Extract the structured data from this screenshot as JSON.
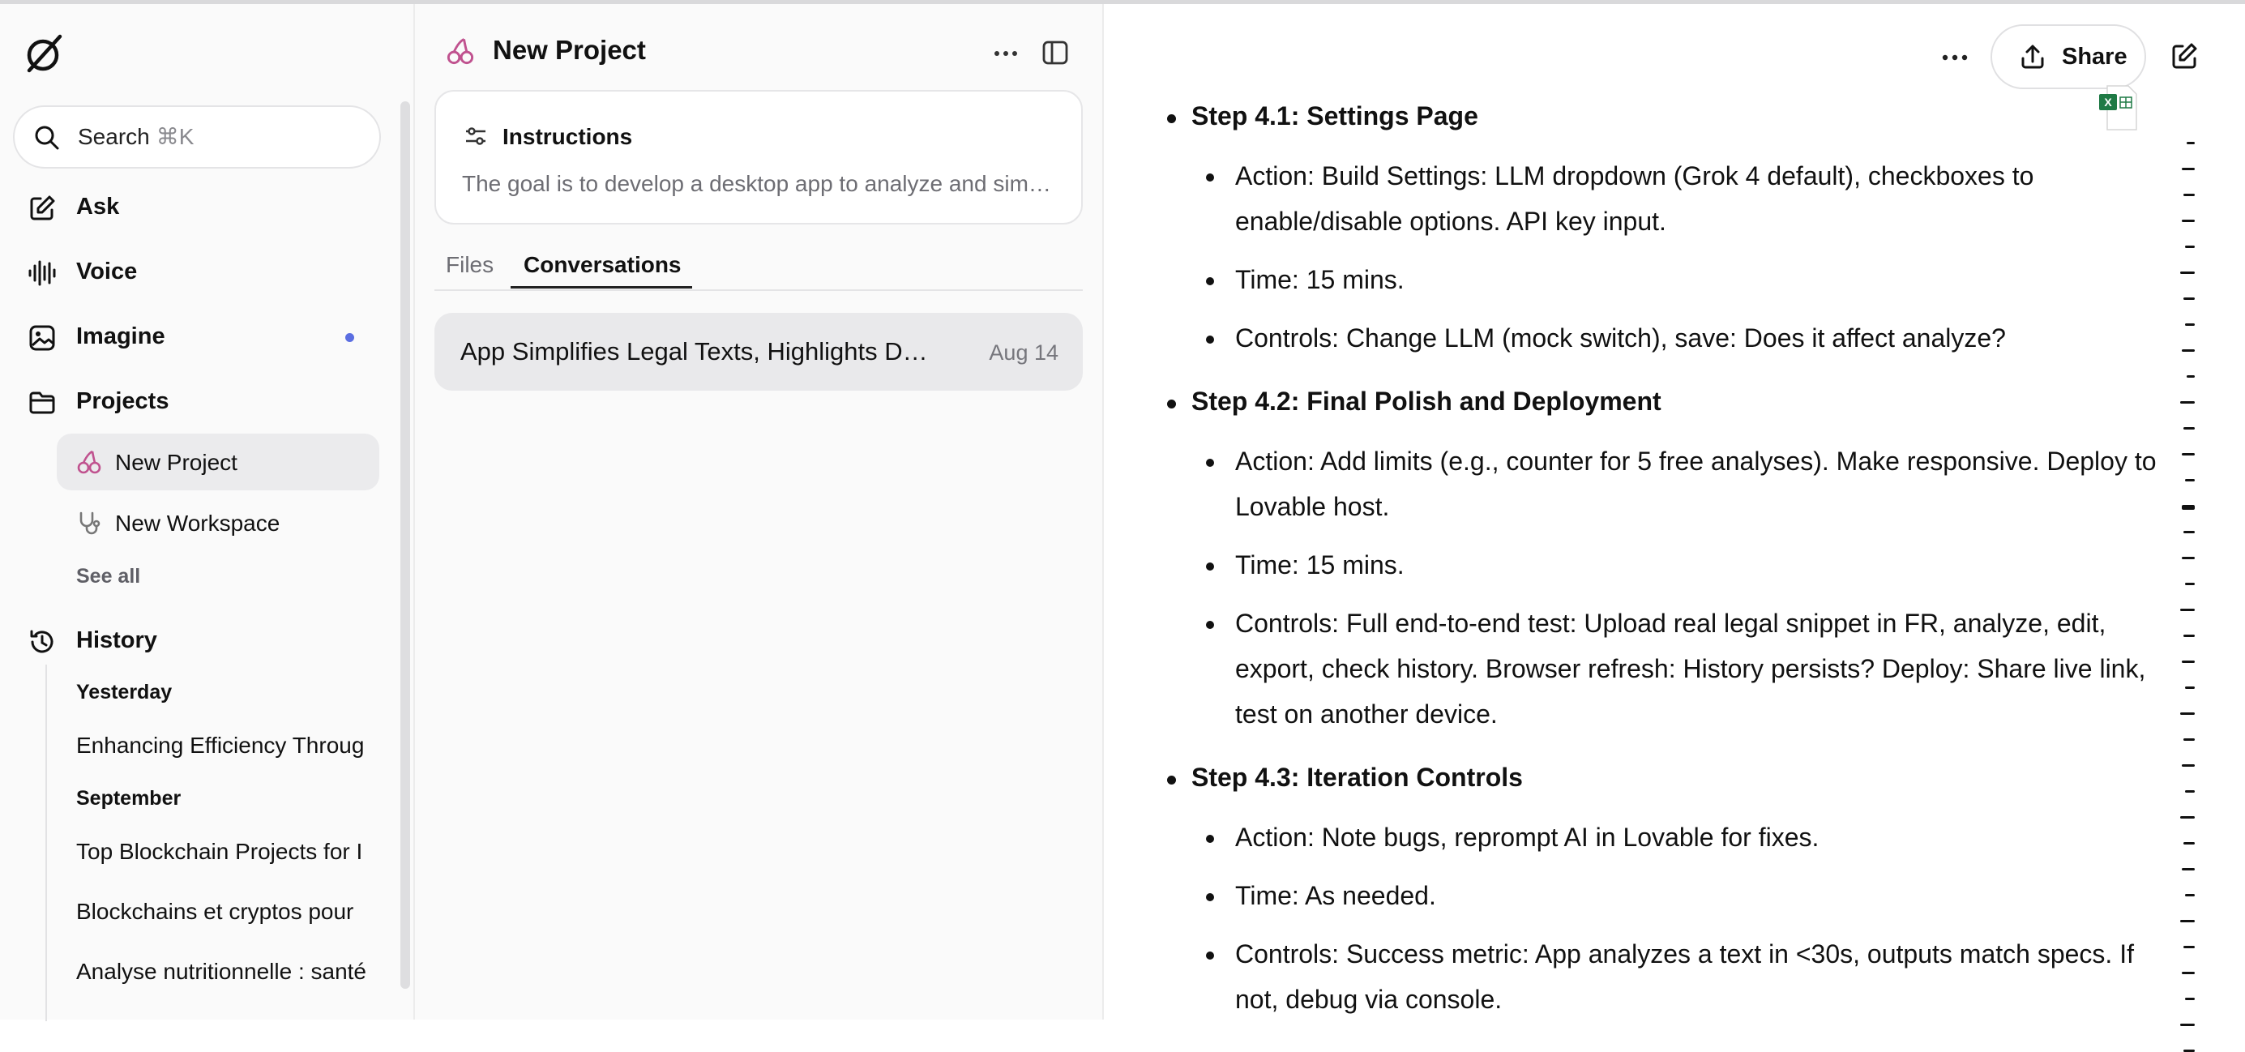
{
  "sidebar": {
    "search": {
      "label": "Search",
      "shortcut": "⌘K"
    },
    "nav": [
      {
        "label": "Ask",
        "icon": "pencil-square-icon"
      },
      {
        "label": "Voice",
        "icon": "waveform-icon"
      },
      {
        "label": "Imagine",
        "icon": "image-icon"
      },
      {
        "label": "Projects",
        "icon": "folder-icon"
      }
    ],
    "projects": [
      {
        "label": "New Project",
        "icon": "cherries-icon"
      },
      {
        "label": "New Workspace",
        "icon": "stethoscope-icon"
      }
    ],
    "see_all": "See all",
    "history": {
      "label": "History",
      "groups": [
        {
          "heading": "Yesterday",
          "items": [
            "Enhancing Efficiency Throug"
          ]
        },
        {
          "heading": "September",
          "items": [
            "Top Blockchain Projects for I",
            "Blockchains et cryptos pour",
            "Analyse nutritionnelle : santé"
          ]
        }
      ]
    }
  },
  "project": {
    "title": "New Project",
    "instructions": {
      "title": "Instructions",
      "text": "The goal is to develop a desktop app to analyze and sim…"
    },
    "tabs": [
      "Files",
      "Conversations"
    ],
    "active_tab": "Conversations",
    "conversations": [
      {
        "title": "App Simplifies Legal Texts, Highlights D…",
        "date": "Aug 14"
      }
    ]
  },
  "header": {
    "share_label": "Share"
  },
  "content": {
    "steps": [
      {
        "title": "Step 4.1: Settings Page",
        "items": [
          "Action: Build Settings: LLM dropdown (Grok 4 default), checkboxes to enable/disable options. API key input.",
          "Time: 15 mins.",
          "Controls: Change LLM (mock switch), save: Does it affect analyze?"
        ]
      },
      {
        "title": "Step 4.2: Final Polish and Deployment",
        "items": [
          "Action: Add limits (e.g., counter for 5 free analyses). Make responsive. Deploy to Lovable host.",
          "Time: 15 mins.",
          "Controls: Full end-to-end test: Upload real legal snippet in FR, analyze, edit, export, check history. Browser refresh: History persists? Deploy: Share live link, test on another device."
        ]
      },
      {
        "title": "Step 4.3: Iteration Controls",
        "items": [
          "Action: Note bugs, reprompt AI in Lovable for fixes.",
          "Time: As needed.",
          "Controls: Success metric: App analyzes a text in <30s, outputs match specs. If not, debug via console."
        ]
      }
    ]
  },
  "colors": {
    "accent_dot": "#5b6ee1",
    "cherries": "#c0528f",
    "excel_green": "#1f7a45"
  }
}
